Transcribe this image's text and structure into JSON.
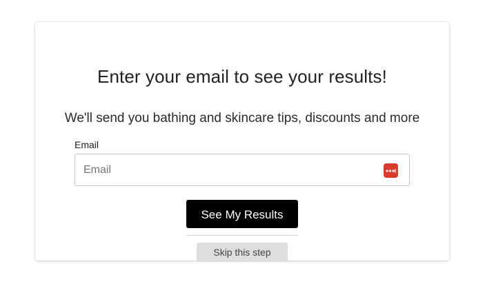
{
  "modal": {
    "title": "Enter your email to see your results!",
    "subtitle": "We'll send you bathing and skincare tips, discounts and more",
    "email_label": "Email",
    "email_value": "",
    "email_placeholder": "Email",
    "password_manager_icon": "password-manager-icon",
    "submit_label": "See My Results",
    "skip_label": "Skip this step"
  },
  "colors": {
    "submit_bg": "#000000",
    "submit_text": "#ffffff",
    "skip_bg": "#dedede",
    "icon_bg": "#d93a2e"
  }
}
